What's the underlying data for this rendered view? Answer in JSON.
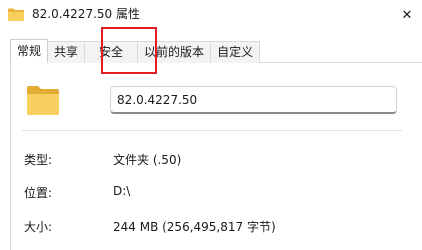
{
  "window": {
    "title": "82.0.4227.50 属性",
    "close_glyph": "✕"
  },
  "tabs": [
    {
      "label": "常规",
      "active": true
    },
    {
      "label": "共享",
      "active": false
    },
    {
      "label": "安全",
      "active": false
    },
    {
      "label": "以前的版本",
      "active": false
    },
    {
      "label": "自定义",
      "active": false
    }
  ],
  "general": {
    "folder_name": "82.0.4227.50",
    "properties": [
      {
        "label": "类型:",
        "value": "文件夹 (.50)"
      },
      {
        "label": "位置:",
        "value": "D:\\"
      },
      {
        "label": "大小:",
        "value": "244 MB (256,495,817 字节)"
      }
    ]
  },
  "icons": {
    "title_icon": "folder-icon",
    "big_icon": "folder-icon",
    "folder_color": "#f2c94c",
    "folder_tab_color": "#e0a92e"
  },
  "annotation": {
    "highlight_color": "#e02020",
    "highlight_target": "安全"
  }
}
